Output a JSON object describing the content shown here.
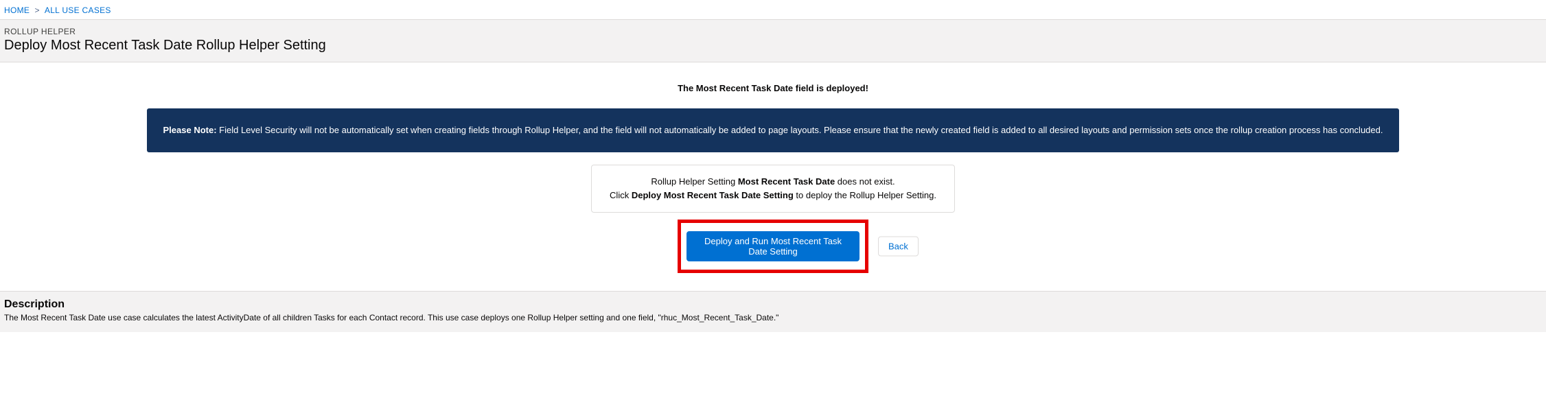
{
  "breadcrumb": {
    "home": "HOME",
    "sep": ">",
    "all_use_cases": "ALL USE CASES"
  },
  "header": {
    "kicker": "ROLLUP HELPER",
    "title": "Deploy Most Recent Task Date Rollup Helper Setting"
  },
  "main": {
    "deployed_message": "The Most Recent Task Date field is deployed!",
    "note": {
      "label": "Please Note:",
      "text": " Field Level Security will not be automatically set when creating fields through Rollup Helper, and the field will not automatically be added to page layouts. Please ensure that the newly created field is added to all desired layouts and permission sets once the rollup creation process has concluded."
    },
    "exist": {
      "line1_pre": "Rollup Helper Setting ",
      "line1_bold": "Most Recent Task Date",
      "line1_post": " does not exist.",
      "line2_pre": "Click ",
      "line2_bold": "Deploy Most Recent Task Date Setting",
      "line2_post": " to deploy the Rollup Helper Setting."
    },
    "buttons": {
      "deploy": "Deploy and Run Most Recent Task Date Setting",
      "back": "Back"
    }
  },
  "description": {
    "heading": "Description",
    "text": "The Most Recent Task Date use case calculates the latest ActivityDate of all children Tasks for each Contact record. This use case deploys one Rollup Helper setting and one field, \"rhuc_Most_Recent_Task_Date.\""
  }
}
